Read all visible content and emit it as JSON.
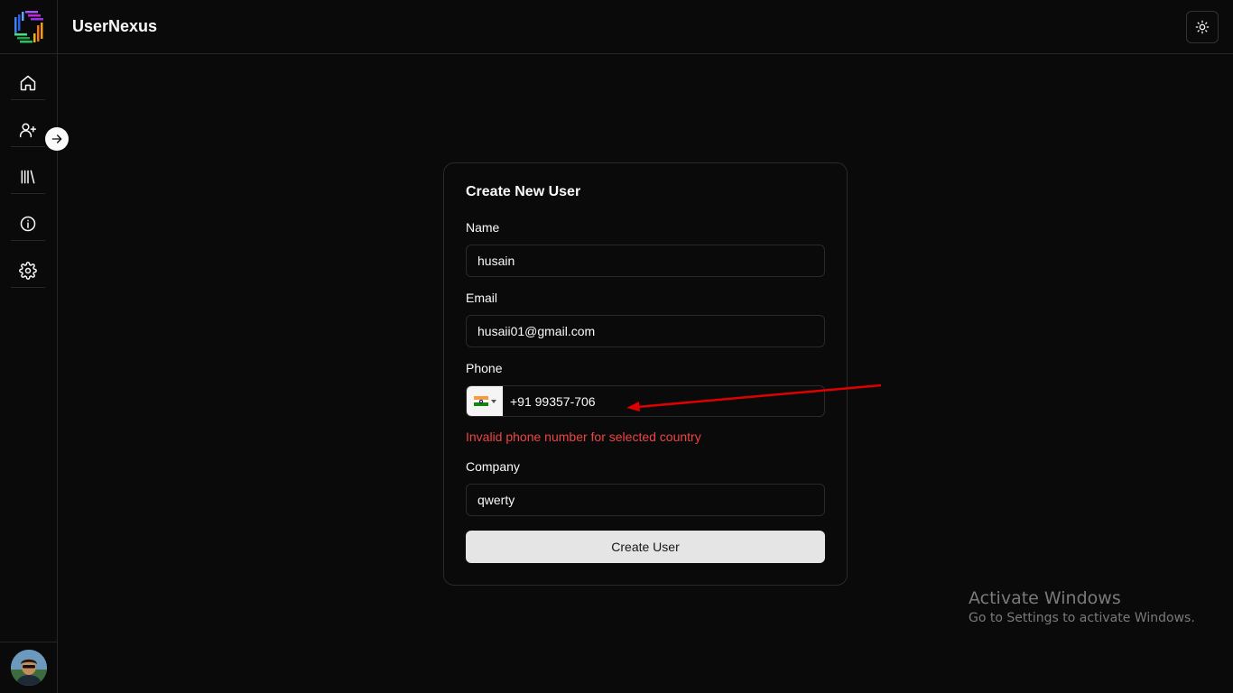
{
  "app": {
    "title": "UserNexus",
    "theme_toggle_icon": "sun-icon"
  },
  "sidebar": {
    "logo_icon": "app-logo-icon",
    "items": [
      {
        "id": "home",
        "icon": "home-icon"
      },
      {
        "id": "add-user",
        "icon": "user-plus-icon"
      },
      {
        "id": "library",
        "icon": "library-icon"
      },
      {
        "id": "info",
        "icon": "info-icon"
      },
      {
        "id": "settings",
        "icon": "gear-icon"
      }
    ],
    "expand_icon": "arrow-right-icon",
    "avatar_icon": "user-avatar"
  },
  "form": {
    "title": "Create New User",
    "name_label": "Name",
    "name_value": "husain",
    "email_label": "Email",
    "email_value": "husaii01@gmail.com",
    "phone_label": "Phone",
    "phone_country": "india-flag-icon",
    "phone_value": "+91 99357-706",
    "phone_error": "Invalid phone number for selected country",
    "company_label": "Company",
    "company_value": "qwerty",
    "submit_label": "Create User"
  },
  "colors": {
    "background": "#0a0a0a",
    "border": "#262626",
    "error": "#ef4444",
    "button_bg": "#e5e5e5",
    "annotation_arrow": "#e00000"
  },
  "watermark": {
    "title": "Activate Windows",
    "subtitle": "Go to Settings to activate Windows."
  }
}
